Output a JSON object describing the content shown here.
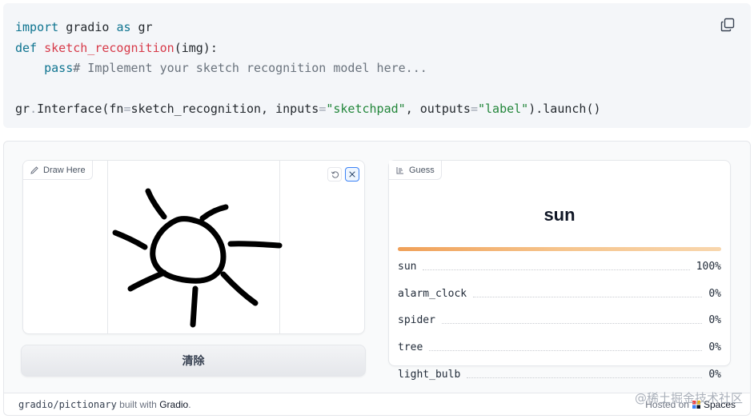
{
  "code": {
    "lines": [
      [
        {
          "t": "import",
          "c": "kw"
        },
        {
          "t": " gradio ",
          "c": ""
        },
        {
          "t": "as",
          "c": "kw"
        },
        {
          "t": " gr",
          "c": ""
        }
      ],
      [
        {
          "t": "def",
          "c": "kw"
        },
        {
          "t": " ",
          "c": ""
        },
        {
          "t": "sketch_recognition",
          "c": "fn"
        },
        {
          "t": "(img):",
          "c": ""
        }
      ],
      [
        {
          "t": "    ",
          "c": ""
        },
        {
          "t": "pass",
          "c": "kw"
        },
        {
          "t": "# Implement your sketch recognition model here...",
          "c": "cm"
        }
      ],
      [],
      [
        {
          "t": "gr",
          "c": ""
        },
        {
          "t": ".",
          "c": "op"
        },
        {
          "t": "Interface(fn",
          "c": ""
        },
        {
          "t": "=",
          "c": "op"
        },
        {
          "t": "sketch_recognition, inputs",
          "c": ""
        },
        {
          "t": "=",
          "c": "op"
        },
        {
          "t": "\"sketchpad\"",
          "c": "str"
        },
        {
          "t": ", outputs",
          "c": ""
        },
        {
          "t": "=",
          "c": "op"
        },
        {
          "t": "\"label\"",
          "c": "str"
        },
        {
          "t": ").launch()",
          "c": ""
        }
      ]
    ],
    "copy_icon": "copy-icon"
  },
  "sketchpad": {
    "label": "Draw Here",
    "icon": "pencil-icon",
    "undo_icon": "undo-icon",
    "clear_icon": "close-icon",
    "clear_button": "清除"
  },
  "output": {
    "label": "Guess",
    "icon": "label-icon",
    "top_label": "sun",
    "top_confidence": 1.0,
    "confidences": [
      {
        "label": "sun",
        "value": "100%"
      },
      {
        "label": "alarm_clock",
        "value": "0%"
      },
      {
        "label": "spider",
        "value": "0%"
      },
      {
        "label": "tree",
        "value": "0%"
      },
      {
        "label": "light_bulb",
        "value": "0%"
      }
    ]
  },
  "footer": {
    "space_name": "gradio/pictionary",
    "built_with": "built with",
    "gradio": "Gradio",
    "hosted_on": "Hosted on",
    "spaces": "Spaces"
  },
  "watermark": "@稀土掘金技术社区",
  "colors": {
    "accent": "#f0a058",
    "keyword": "#0e7490",
    "function": "#d73a49",
    "string": "#22863a"
  }
}
